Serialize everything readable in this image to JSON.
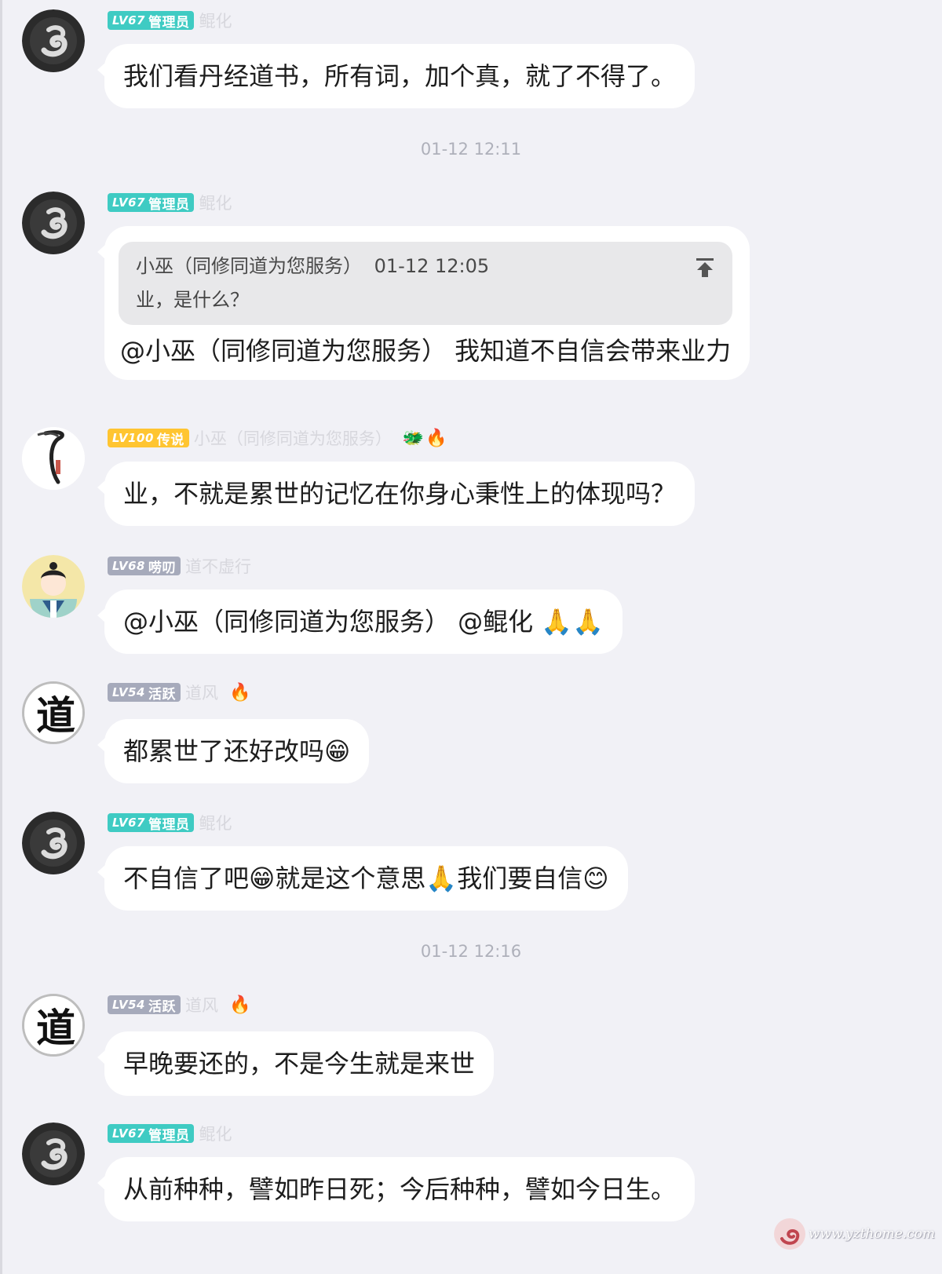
{
  "messages": [
    {
      "level": "LV67",
      "role": "管理员",
      "name": "鲲化",
      "text": "我们看丹经道书，所有词，加个真，就了不得了。"
    },
    {
      "level": "LV67",
      "role": "管理员",
      "name": "鲲化",
      "quote": {
        "author": "小巫（同修同道为您服务）",
        "time": "01-12 12:05",
        "text": "业，是什么？"
      },
      "text": "@小巫（同修同道为您服务） 我知道不自信会带来业力"
    },
    {
      "level": "LV100",
      "role": "传说",
      "name": "小巫（同修同道为您服务）",
      "emojis": [
        "🐲",
        "🔥"
      ],
      "text": "业，不就是累世的记忆在你身心秉性上的体现吗？"
    },
    {
      "level": "LV68",
      "role": "唠叨",
      "name": "道不虚行",
      "text": "@小巫（同修同道为您服务） @鲲化 🙏🙏"
    },
    {
      "level": "LV54",
      "role": "活跃",
      "name": "道风",
      "emojis": [
        "🔥"
      ],
      "text": "都累世了还好改吗😁"
    },
    {
      "level": "LV67",
      "role": "管理员",
      "name": "鲲化",
      "text": "不自信了吧😁就是这个意思🙏我们要自信😊"
    },
    {
      "level": "LV54",
      "role": "活跃",
      "name": "道风",
      "emojis": [
        "🔥"
      ],
      "text": "早晚要还的，不是今生就是来世"
    },
    {
      "level": "LV67",
      "role": "管理员",
      "name": "鲲化",
      "text": "从前种种，譬如昨日死；今后种种，譬如今日生。"
    }
  ],
  "timestamps": [
    "01-12 12:11",
    "01-12 12:16"
  ],
  "icons": {
    "jump_to_quote": "arrow-up-to-top-icon"
  },
  "colors": {
    "admin_badge": "#3fcbc3",
    "legend_badge": "#ffc531",
    "member_badge": "#a6aabb",
    "background": "#f1f1f6"
  },
  "watermark": "www.yzthome.com"
}
